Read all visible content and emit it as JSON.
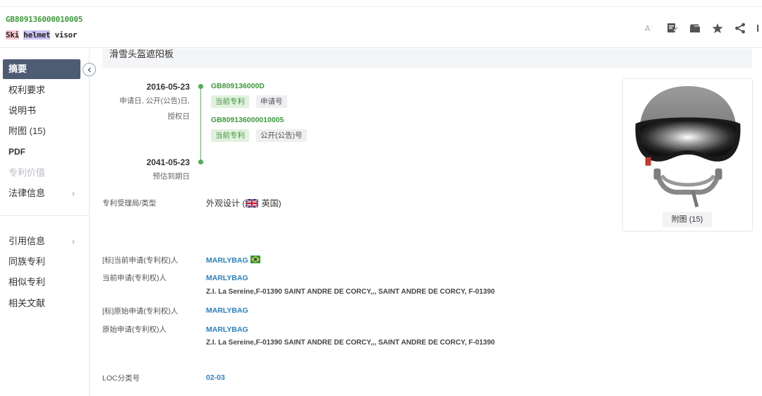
{
  "header": {
    "pub_no": "GB809136000010005",
    "title_part1": "Ski",
    "title_part2": "helmet",
    "title_part3": "visor"
  },
  "toolbar": {
    "icons": [
      "font-size-icon",
      "edit-note-icon",
      "folder-icon",
      "star-icon",
      "share-icon"
    ]
  },
  "sidebar": {
    "items": [
      {
        "label": "摘要"
      },
      {
        "label": "权利要求"
      },
      {
        "label": "说明书"
      },
      {
        "label": "附图 (15)"
      },
      {
        "label": "PDF"
      },
      {
        "label": "专利价值"
      },
      {
        "label": "法律信息"
      },
      {
        "label": "引用信息"
      },
      {
        "label": "同族专利"
      },
      {
        "label": "相似专利"
      },
      {
        "label": "相关文献"
      }
    ],
    "chevron": "›"
  },
  "main": {
    "cn_title": "滑雪头盔遮阳板",
    "timeline": {
      "date1": "2016-05-23",
      "date1_sub": "申请日, 公开(公告)日,",
      "date1_sub2": "授权日",
      "app_no": "GB809136000D",
      "tag_current": "当前专利",
      "tag_app": "申请号",
      "pub_no": "GB809136000010005",
      "tag_current2": "当前专利",
      "tag_pub": "公开(公告)号",
      "date2": "2041-05-23",
      "date2_sub": "预估到期日"
    },
    "office": {
      "label": "专利受理局/类型",
      "value_prefix": "外观设计 (",
      "value_suffix": " 英国)"
    },
    "applicants": [
      {
        "label": "[标]当前申请(专利权)人",
        "name": "MARLYBAG",
        "addr": ""
      },
      {
        "label": "当前申请(专利权)人",
        "name": "MARLYBAG",
        "addr": "Z.I. La Sereine,F-01390 SAINT ANDRE DE CORCY,,, SAINT ANDRE DE CORCY, F-01390"
      },
      {
        "label": "[标]原始申请(专利权)人",
        "name": "MARLYBAG",
        "addr": ""
      },
      {
        "label": "原始申请(专利权)人",
        "name": "MARLYBAG",
        "addr": "Z.I. La Sereine,F-01390 SAINT ANDRE DE CORCY,,, SAINT ANDRE DE CORCY, F-01390"
      }
    ],
    "loc": {
      "label": "LOC分类号",
      "value": "02-03"
    },
    "image_caption": "附图 (15)"
  },
  "colors": {
    "accent_green": "#3c9a3c",
    "link_blue": "#2a7fc4",
    "sidebar_active": "#4d5b73"
  }
}
